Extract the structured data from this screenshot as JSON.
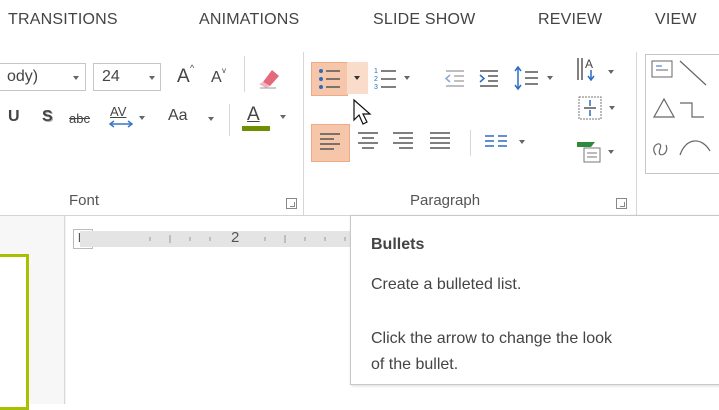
{
  "tabs": [
    "TRANSITIONS",
    "ANIMATIONS",
    "SLIDE SHOW",
    "REVIEW",
    "VIEW"
  ],
  "font_group": {
    "font_name": "ody)",
    "font_size": "24",
    "label": "Font",
    "strike_label": "abc",
    "char_spacing_label": "AV",
    "change_case_label": "Aa",
    "font_color_label": "A",
    "grow_label": "A",
    "shrink_label": "A",
    "shadow_label": "S",
    "underline_label": "U"
  },
  "paragraph_group": {
    "label": "Paragraph"
  },
  "ruler": {
    "tab_marker": "L",
    "mark_2": "2"
  },
  "tooltip": {
    "title": "Bullets",
    "line1": "Create a bulleted list.",
    "line2": "Click the arrow to change the look",
    "line3": "of the bullet."
  },
  "colors": {
    "accent_highlight": "#f5c6aa",
    "font_color_bar": "#6e8f00",
    "slide_edge": "#a8c000"
  }
}
